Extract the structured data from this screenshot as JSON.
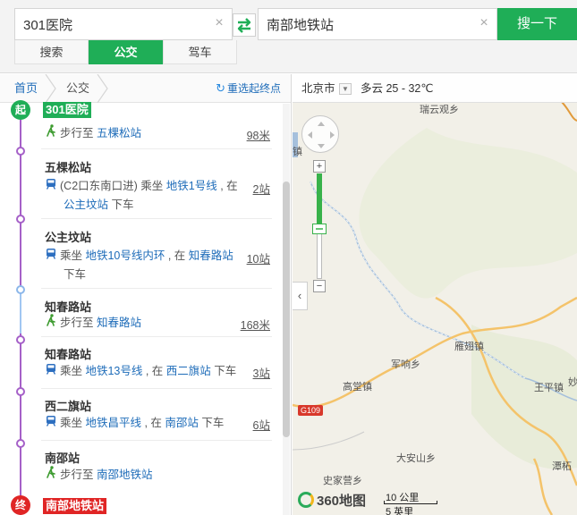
{
  "search": {
    "from_value": "301医院",
    "to_value": "南部地铁站",
    "button": "搜一下",
    "clear_icon": "×",
    "tabs": [
      {
        "label": "搜索",
        "active": false
      },
      {
        "label": "公交",
        "active": true
      },
      {
        "label": "驾车",
        "active": false
      }
    ]
  },
  "breadcrumb": {
    "home": "首页",
    "current": "公交",
    "reselect": "重选起终点"
  },
  "route": {
    "start_badge": "起",
    "start_name": "301医院",
    "end_badge": "终",
    "end_name": "南部地铁站",
    "steps": [
      {
        "station": "",
        "pre": "步行至 ",
        "link1": "五棵松站",
        "mid": "",
        "link2": "",
        "post": "",
        "count": "98米"
      },
      {
        "station": "五棵松站",
        "pre": "(C2口东南口进) 乘坐 ",
        "link1": "地铁1号线",
        "mid": " , 在 ",
        "link2": "公主坟站",
        "post": " 下车",
        "count": "2站"
      },
      {
        "station": "公主坟站",
        "pre": "乘坐 ",
        "link1": "地铁10号线内环",
        "mid": " , 在 ",
        "link2": "知春路站",
        "post": " 下车",
        "count": "10站"
      },
      {
        "station": "知春路站",
        "pre": "步行至 ",
        "link1": "知春路站",
        "mid": "",
        "link2": "",
        "post": "",
        "count": "168米"
      },
      {
        "station": "知春路站",
        "pre": "乘坐 ",
        "link1": "地铁13号线",
        "mid": " , 在 ",
        "link2": "西二旗站",
        "post": " 下车",
        "count": "3站"
      },
      {
        "station": "西二旗站",
        "pre": "乘坐 ",
        "link1": "地铁昌平线",
        "mid": " , 在 ",
        "link2": "南邵站",
        "post": " 下车",
        "count": "6站"
      },
      {
        "station": "南邵站",
        "pre": "步行至 ",
        "link1": "南邵地铁站",
        "mid": "",
        "link2": "",
        "post": "",
        "count": ""
      }
    ]
  },
  "map": {
    "city": "北京市",
    "weather": "多云 25 - 32℃",
    "labels": [
      "瑞云观乡",
      "镇",
      "雁翅镇",
      "军响乡",
      "高堂镇",
      "王平镇",
      "妙",
      "大安山乡",
      "史家营乡",
      "潭柘"
    ],
    "road_sign": "G109",
    "logo": "360地图",
    "scale_top": "10 公里",
    "scale_bottom": "5 英里",
    "colors": {
      "accent": "#1fae57",
      "subway_line": "#a560c8",
      "walk_line": "#8cb7ea",
      "end": "#e02525"
    }
  }
}
